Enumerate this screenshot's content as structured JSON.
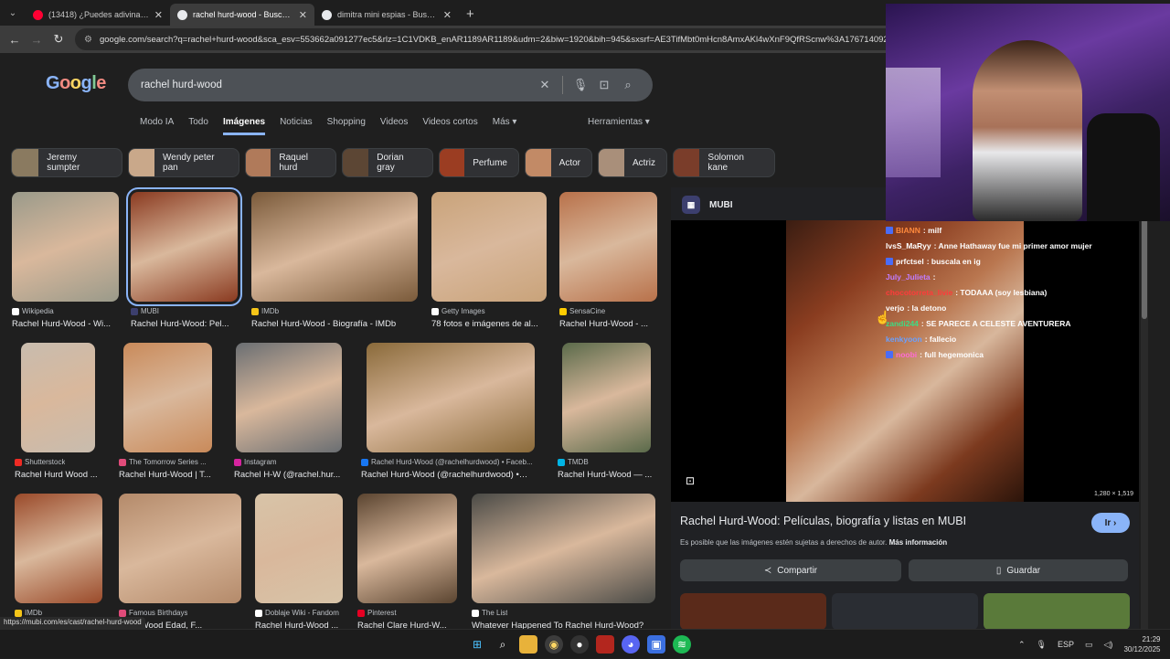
{
  "browser": {
    "tabs": [
      {
        "title": "(13418) ¿Puedes adivinar la PE...",
        "active": false,
        "favicon_color": "#ff0033"
      },
      {
        "title": "rachel hurd-wood - Buscar con...",
        "active": true,
        "favicon_color": "#e8eaed"
      },
      {
        "title": "dimitra mini espias - Buscar co...",
        "active": false,
        "favicon_color": "#e8eaed"
      }
    ],
    "new_tab": "+",
    "url": "google.com/search?q=rachel+hurd-wood&sca_esv=553662a091277ec5&rlz=1C1VDKB_enAR1189AR1189&udm=2&biw=1920&bih=945&sxsrf=AE3TifMbt0mHcn8AmxAKl4wXnF9QfRScnw%3A176714092252980"
  },
  "google": {
    "logo": "Google",
    "query": "rachel hurd-wood",
    "filters": [
      "Modo IA",
      "Todo",
      "Imágenes",
      "Noticias",
      "Shopping",
      "Videos",
      "Videos cortos",
      "Más ▾"
    ],
    "active_filter": "Imágenes",
    "tools": "Herramientas ▾",
    "chips": [
      {
        "label": "Jeremy sumpter",
        "color": "#8a7a60"
      },
      {
        "label": "Wendy peter pan",
        "color": "#c9a88a"
      },
      {
        "label": "Raquel hurd",
        "color": "#b07a5a"
      },
      {
        "label": "Dorian gray",
        "color": "#5c4634"
      },
      {
        "label": "Perfume",
        "color": "#9b3d22"
      },
      {
        "label": "Actor",
        "color": "#c28a66"
      },
      {
        "label": "Actriz",
        "color": "#a98f7a"
      },
      {
        "label": "Solomon kane",
        "color": "#7a3d2a"
      }
    ],
    "results": [
      {
        "source": "Wikipedia",
        "caption": "Rachel Hurd-Wood - Wi...",
        "color": "#9a9a8a",
        "fav": "#ffffff"
      },
      {
        "source": "MUBI",
        "caption": "Rachel Hurd-Wood: Pel...",
        "color": "#8a3a20",
        "fav": "#3c3f6e"
      },
      {
        "source": "IMDb",
        "caption": "Rachel Hurd-Wood - Biografía - IMDb",
        "color": "#7a5a3a",
        "fav": "#f5c518"
      },
      {
        "source": "Getty Images",
        "caption": "78 fotos e imágenes de al...",
        "color": "#c9a37a",
        "fav": "#ffffff"
      },
      {
        "source": "SensaCine",
        "caption": "Rachel Hurd-Wood - ...",
        "color": "#b8714a",
        "fav": "#ffcc00"
      },
      {
        "source": "Shutterstock",
        "caption": "Rachel Hurd Wood ...",
        "color": "#c8bcae",
        "fav": "#ee2b24"
      },
      {
        "source": "The Tomorrow Series ...",
        "caption": "Rachel Hurd-Wood | T...",
        "color": "#c98a5a",
        "fav": "#e04b7a"
      },
      {
        "source": "Instagram",
        "caption": "Rachel H-W (@rachel.hur...",
        "color": "#6a6e72",
        "fav": "#d6249f"
      },
      {
        "source": "Rachel Hurd-Wood (@rachelhurdwood) • Faceb...",
        "caption": "Rachel Hurd-Wood (@rachelhurdwood) • F...",
        "color": "#8a6a3a",
        "fav": "#1877f2"
      },
      {
        "source": "TMDB",
        "caption": "Rachel Hurd-Wood — ...",
        "color": "#5a6a4a",
        "fav": "#01b4e4"
      },
      {
        "source": "IMDb",
        "caption": "",
        "color": "#9a4a2a",
        "fav": "#f5c518"
      },
      {
        "source": "Famous Birthdays",
        "caption": "Hurd-Wood Edad, F...",
        "color": "#b48a6a",
        "fav": "#e04b7a"
      },
      {
        "source": "Doblaje Wiki - Fandom",
        "caption": "Rachel Hurd-Wood ...",
        "color": "#d8c4a8",
        "fav": "#ffffff"
      },
      {
        "source": "Pinterest",
        "caption": "Rachel Clare Hurd-W...",
        "color": "#5a4430",
        "fav": "#e60023"
      },
      {
        "source": "The List",
        "caption": "Whatever Happened To Rachel Hurd-Wood?",
        "color": "#4a4a46",
        "fav": "#ffffff"
      }
    ]
  },
  "panel": {
    "site": "MUBI",
    "site_logo": "▦",
    "dims": "1,280 × 1,519",
    "title": "Rachel Hurd-Wood: Películas, biografía y listas en MUBI",
    "go": "Ir ›",
    "note": "Es posible que las imágenes estén sujetas a derechos de autor.",
    "more_info": "Más información",
    "share": "Compartir",
    "save": "Guardar"
  },
  "chat": [
    {
      "user": "BIANN",
      "text": ": milf",
      "color": "#ff8a3d",
      "badge": true
    },
    {
      "user": "IvsS_MaRyy",
      "text": ": Anne Hathaway fue mi primer amor mujer",
      "color": "#ffffff",
      "badge": false
    },
    {
      "user": "prfctsel",
      "text": ": buscala en ig",
      "color": "#ffffff",
      "badge": true
    },
    {
      "user": "July_Julieta",
      "text": ":",
      "color": "#c07cff",
      "badge": false
    },
    {
      "user": "chocotorreta_livie",
      "text": ": TODAAA (soy lesbiana)",
      "color": "#ff3b3b",
      "badge": false
    },
    {
      "user": "verjo",
      "text": ": la detono",
      "color": "#ffffff",
      "badge": false
    },
    {
      "user": "zandi244",
      "text": ": SE PARECE A CELESTE AVENTURERA",
      "color": "#3ddc84",
      "badge": false
    },
    {
      "user": "kenkyoon",
      "text": ": fallecio",
      "color": "#6aa0ff",
      "badge": false
    },
    {
      "user": "noobi",
      "text": ": full hegemonica",
      "color": "#ff6bd6",
      "badge": true
    }
  ],
  "status_url": "https://mubi.com/es/cast/rachel-hurd-wood",
  "taskbar": {
    "lang": "ESP",
    "time": "21:29",
    "date": "30/12/2025"
  }
}
